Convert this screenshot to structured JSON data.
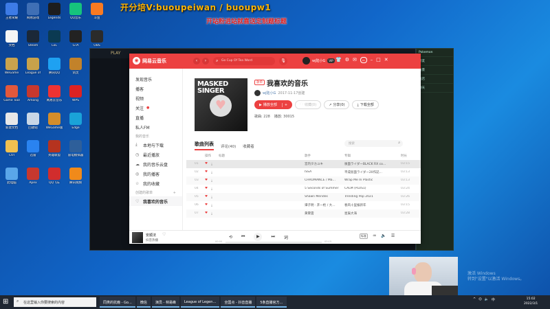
{
  "overlay": {
    "title": "开分培V:buoupeiwan / buoupw1",
    "subtitle": "开站粉进站就喜送定制题标题"
  },
  "desktop_icons": [
    {
      "label": "王者荣耀",
      "color": "#3d7be6"
    },
    {
      "label": "文档",
      "color": "#f5f5f5"
    },
    {
      "label": "WeGame",
      "color": "#c9a34d"
    },
    {
      "label": "Game Tool",
      "color": "#e2583c"
    },
    {
      "label": "新建文档",
      "color": "#e8e8e8"
    },
    {
      "label": "Ctrl",
      "color": "#f0c050"
    },
    {
      "label": "此电脑",
      "color": "#5aa6e9"
    },
    {
      "label": "网易游戏",
      "color": "#3f6fb5"
    },
    {
      "label": "Steam",
      "color": "#1b2838"
    },
    {
      "label": "League of",
      "color": "#c8a24a"
    },
    {
      "label": "Among",
      "color": "#c7382e"
    },
    {
      "label": "回收站",
      "color": "#c9d7e6"
    },
    {
      "label": "迅雷",
      "color": "#2a83f0"
    },
    {
      "label": "Apex",
      "color": "#c7382e"
    },
    {
      "label": "Legends",
      "color": "#1d1d1d"
    },
    {
      "label": "LoL",
      "color": "#0b3a52"
    },
    {
      "label": "腾讯QQ",
      "color": "#1ea1f2"
    },
    {
      "label": "网易云音乐",
      "color": "#e33"
    },
    {
      "label": "WeGame版",
      "color": "#d38d2a"
    },
    {
      "label": "英雄联盟",
      "color": "#b5331f"
    },
    {
      "label": "QQ飞车",
      "color": "#d12d2d"
    },
    {
      "label": "QQ音乐",
      "color": "#16c37c"
    },
    {
      "label": "GTA",
      "color": "#222"
    },
    {
      "label": "剑灵",
      "color": "#c2822a"
    },
    {
      "label": "WPS",
      "color": "#d22"
    },
    {
      "label": "Edge",
      "color": "#1aa3d8"
    },
    {
      "label": "雷电模拟器",
      "color": "#2e5f9a"
    },
    {
      "label": "腾讯视频",
      "color": "#f08a1a"
    },
    {
      "label": "斗鱼",
      "color": "#f87a22"
    },
    {
      "label": "OBS",
      "color": "#2b2b2b"
    },
    {
      "label": "微信",
      "color": "#23b34a"
    },
    {
      "label": "快手",
      "color": "#f2c230"
    },
    {
      "label": "UU加速器",
      "color": "#f2c230"
    },
    {
      "label": "Chrome",
      "color": "#e8e8e8"
    },
    {
      "label": "NVIDIA",
      "color": "#76b900"
    }
  ],
  "game_window": {
    "title": "PLAY"
  },
  "side_panel": {
    "items": [
      "Pokemon",
      "好友",
      "背景",
      "商店",
      "聊天"
    ]
  },
  "app": {
    "logo": "网易云音乐",
    "search_placeholder": "Go Cup Of Tea Word",
    "username": "wj陆小G",
    "vip_label": "VIP",
    "nav": [
      {
        "label": "发现音乐",
        "type": "item"
      },
      {
        "label": "播客",
        "type": "item"
      },
      {
        "label": "视频",
        "type": "item"
      },
      {
        "label": "关注",
        "type": "item",
        "dot": true
      },
      {
        "label": "直播",
        "type": "item"
      },
      {
        "label": "私人FM",
        "type": "item"
      },
      {
        "label": "我的音乐",
        "type": "section"
      },
      {
        "label": "本地与下载",
        "type": "item",
        "icon": "⤓"
      },
      {
        "label": "最近播放",
        "type": "item",
        "icon": "◷"
      },
      {
        "label": "我的音乐云盘",
        "type": "item",
        "icon": "☁"
      },
      {
        "label": "我的播客",
        "type": "item",
        "icon": "◎"
      },
      {
        "label": "我的收藏",
        "type": "item",
        "icon": "☆"
      },
      {
        "label": "创建的歌单",
        "type": "section",
        "plus": "+"
      },
      {
        "label": "我喜欢的音乐",
        "type": "item",
        "icon": "♡",
        "active": true
      }
    ],
    "playlist": {
      "cover_text": "MASKED\nSINGER",
      "tag": "歌单",
      "title": "我喜欢的音乐",
      "creator": "wj陆小G",
      "created": "2017-11-17创建",
      "btn_play": "播放全部",
      "btn_plus": "+",
      "btn_collect": "收藏(0)",
      "btn_share": "分享(0)",
      "btn_download": "下载全部",
      "stats_songs_label": "歌曲",
      "stats_songs": "228",
      "stats_plays_label": "播放",
      "stats_plays": "30015"
    },
    "tabs": [
      {
        "label": "歌曲列表",
        "active": true
      },
      {
        "label": "评论(40)"
      },
      {
        "label": "收藏者"
      }
    ],
    "track_search_placeholder": "搜索",
    "columns": {
      "ops": "操作",
      "title": "标题",
      "artist": "歌手",
      "album": "专辑",
      "duration": "时长"
    },
    "tracks": [
      {
        "idx": "01",
        "title": "后面ライダーBLACK RX",
        "alias": "(电视剧《假面骑士BLA…",
        "tag": "",
        "artist": "宮内タカユキ",
        "album": "後面ライダーBLACK RX co…",
        "duration": "03:15"
      },
      {
        "idx": "02",
        "title": "Justsy's",
        "alias": "(电视剧《平成(2021)》主题曲",
        "tag": "",
        "artist": "ISSA",
        "album": "平成仮面ライダー20作記…",
        "duration": "03:13"
      },
      {
        "idx": "03",
        "title": "Wrap Me In Plastic",
        "alias": "",
        "tag": "SQ",
        "artist": "CHROMANCE / Ma…",
        "album": "Wrap Me In Plastic",
        "duration": "03:13"
      },
      {
        "idx": "04",
        "title": "Teeth",
        "alias": "",
        "tag": "SQ",
        "artist": "5 Seconds of Summer",
        "album": "CALM (PLUS1)",
        "duration": "03:24"
      },
      {
        "idx": "05",
        "title": "Stitches",
        "alias": "",
        "tag": "SQ",
        "artist": "Shawn Mendes",
        "album": "Trending Pop 2021",
        "duration": "03:26"
      },
      {
        "idx": "06",
        "title": "春风十里报新年",
        "alias": "(2020浙江卫视春晚)",
        "tag": "",
        "artist": "谭子明 · 开一枪 / 大…",
        "album": "春风十里报新年",
        "duration": "03:15"
      },
      {
        "idx": "07",
        "title": "星辰大海",
        "alias": "",
        "tag": "",
        "artist": "黄霄雲",
        "album": "星辰大海",
        "duration": "03:28"
      }
    ],
    "player": {
      "title": "安顺法",
      "artist": "抖音热播",
      "time_current": "00:00",
      "time_total": "03:15",
      "progress_fraction": 0.0,
      "quality": "标准"
    }
  },
  "taskbar": {
    "search_placeholder": "在这里输入你要搜索的内容",
    "apps": [
      "同类的抗瘾 - Go…",
      "微信",
      "演员 - 林易峰",
      "League of Legen…",
      "全国点 - 抖音直播",
      "5条直播官方…"
    ],
    "time": "15:02",
    "date": "2022/3/1"
  },
  "watermark": {
    "line1": "激活 Windows",
    "line2": "转到\"设置\"以激活 Windows。"
  }
}
